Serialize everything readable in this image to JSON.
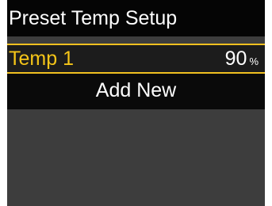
{
  "header": {
    "title": "Preset Temp Setup"
  },
  "presets": [
    {
      "name": "Temp 1",
      "value": "90",
      "unit": "%"
    }
  ],
  "actions": {
    "add_new_label": "Add New"
  },
  "colors": {
    "background": "#3d3d3d",
    "header_bg": "#050505",
    "highlight": "#f0c020",
    "selected_text": "#f5c518",
    "text": "#ffffff"
  }
}
